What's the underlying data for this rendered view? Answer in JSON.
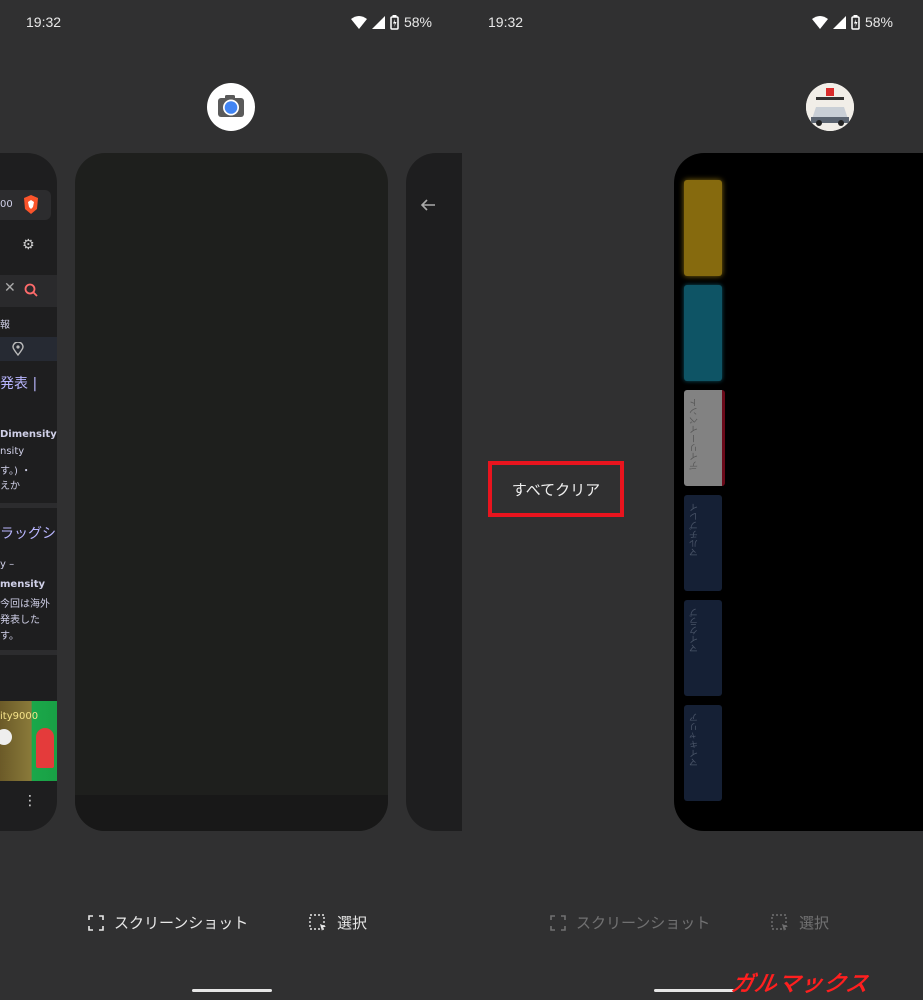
{
  "left": {
    "status": {
      "time": "19:32",
      "battery": "58%"
    },
    "icon": "camera-app-icon",
    "prev_card": {
      "f1": "00",
      "f2": "報",
      "f3": "発表 |",
      "f4": "Dimensity",
      "f5": "nsity",
      "f6": "す。) ・",
      "f7": "えか",
      "f8": "ラッグシ",
      "f9": "y –",
      "f10": "mensity",
      "f11": "今回は海外",
      "f12": "発表した",
      "f13": "す。",
      "f14": "ity9000"
    },
    "actions": {
      "screenshot": "スクリーンショット",
      "select": "選択"
    }
  },
  "right": {
    "status": {
      "time": "19:32",
      "battery": "58%"
    },
    "icon": "asphalt-9-app-icon",
    "clear_all": "すべてクリア",
    "game_tabs": [
      {
        "label": "",
        "color": "#f4c21a"
      },
      {
        "label": "",
        "color": "#1b9ab8"
      },
      {
        "label": "デイリーイベント",
        "color": "#d9d9d9"
      },
      {
        "label": "マルチプレイ",
        "color": "#1c2b47"
      },
      {
        "label": "マイクラブ",
        "color": "#1c2b47"
      },
      {
        "label": "マイキャリア",
        "color": "#1c2b47"
      }
    ],
    "actions": {
      "screenshot": "スクリーンショット",
      "select": "選択"
    },
    "watermark": "ガルマックス"
  },
  "colors": {
    "background": "#303031",
    "highlight_red": "#e8141e"
  }
}
